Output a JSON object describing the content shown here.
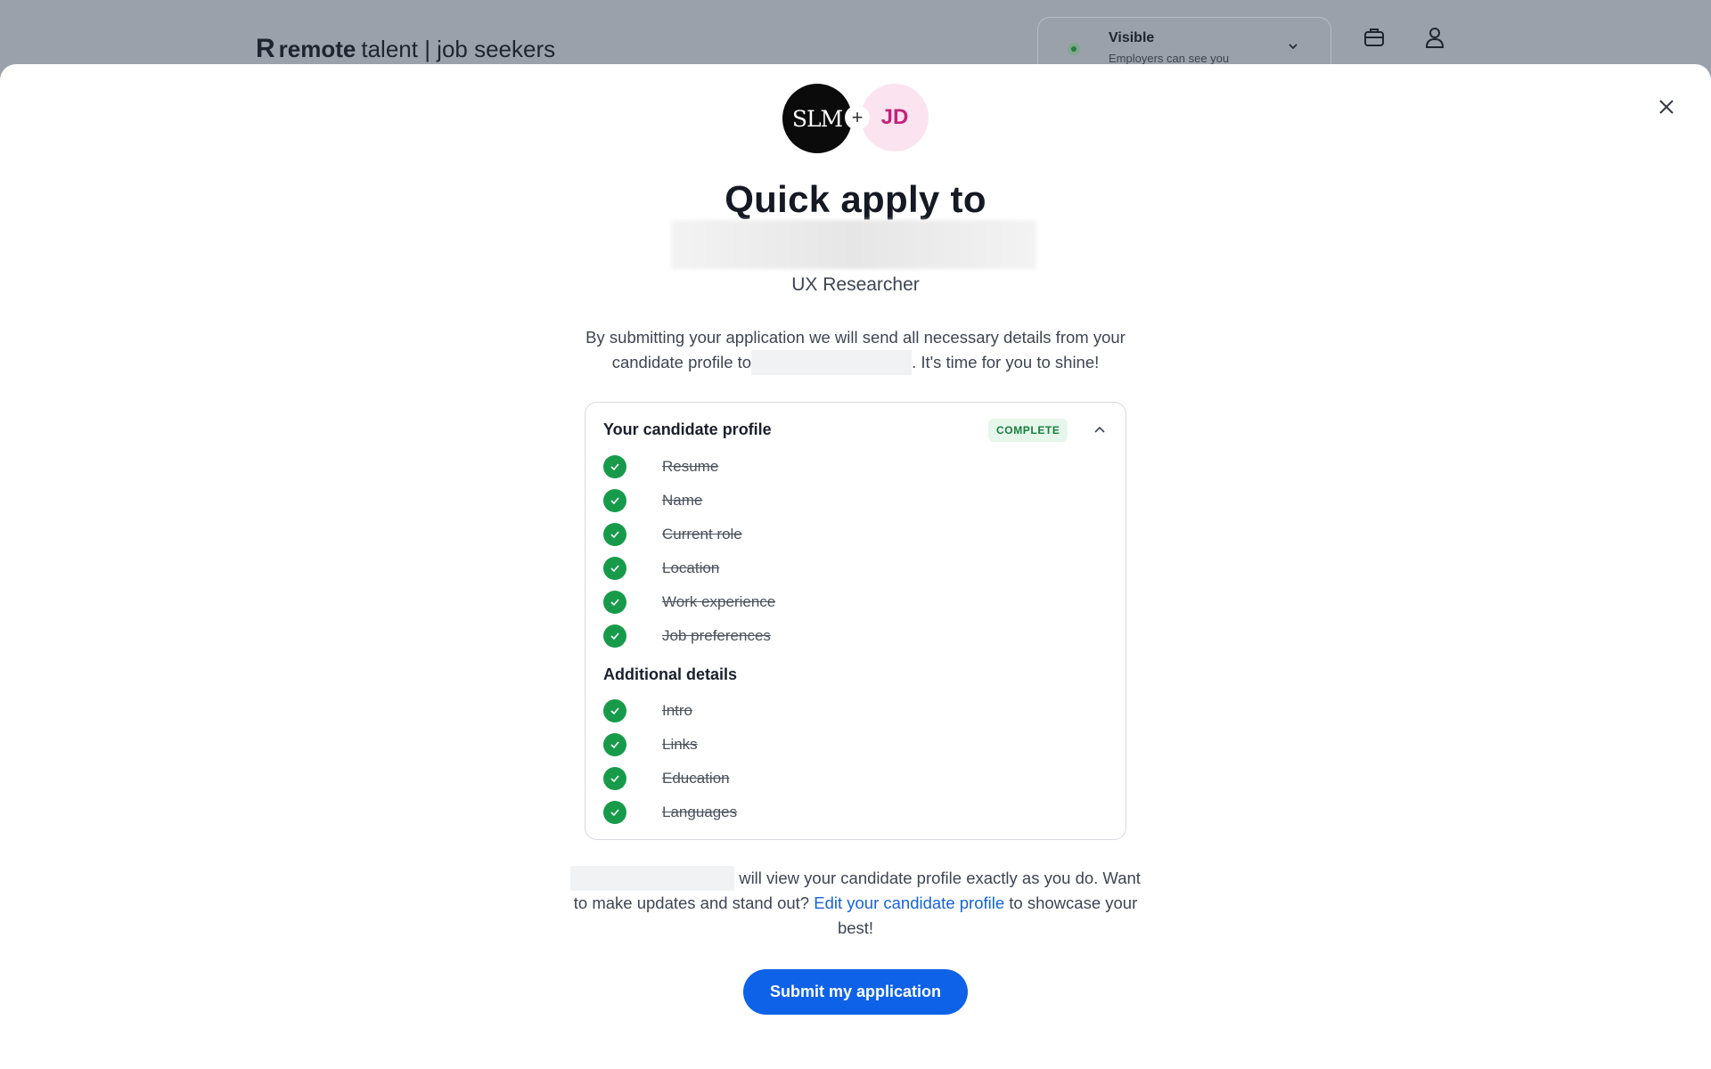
{
  "header": {
    "brand_bold": "remote",
    "brand_light": "talent | job seekers",
    "visibility": {
      "title": "Visible",
      "subtitle": "Employers can see you"
    }
  },
  "modal": {
    "company_avatar": "SLM",
    "user_avatar": "JD",
    "plus": "+",
    "title": "Quick apply to",
    "role": "UX Researcher",
    "description_part1": "By submitting your application we will send all necessary details from your candidate profile to",
    "description_part2": ". It's time for you to shine!",
    "profile_card": {
      "heading": "Your candidate profile",
      "status": "COMPLETE",
      "items": [
        "Resume",
        "Name",
        "Current role",
        "Location",
        "Work experience",
        "Job preferences"
      ],
      "additional_heading": "Additional details",
      "additional_items": [
        "Intro",
        "Links",
        "Education",
        "Languages"
      ]
    },
    "note_part1": "will view your candidate profile exactly as you do. Want to make updates and stand out?",
    "note_link": "Edit your candidate profile",
    "note_part2": "to showcase your best!",
    "submit_label": "Submit my application"
  }
}
